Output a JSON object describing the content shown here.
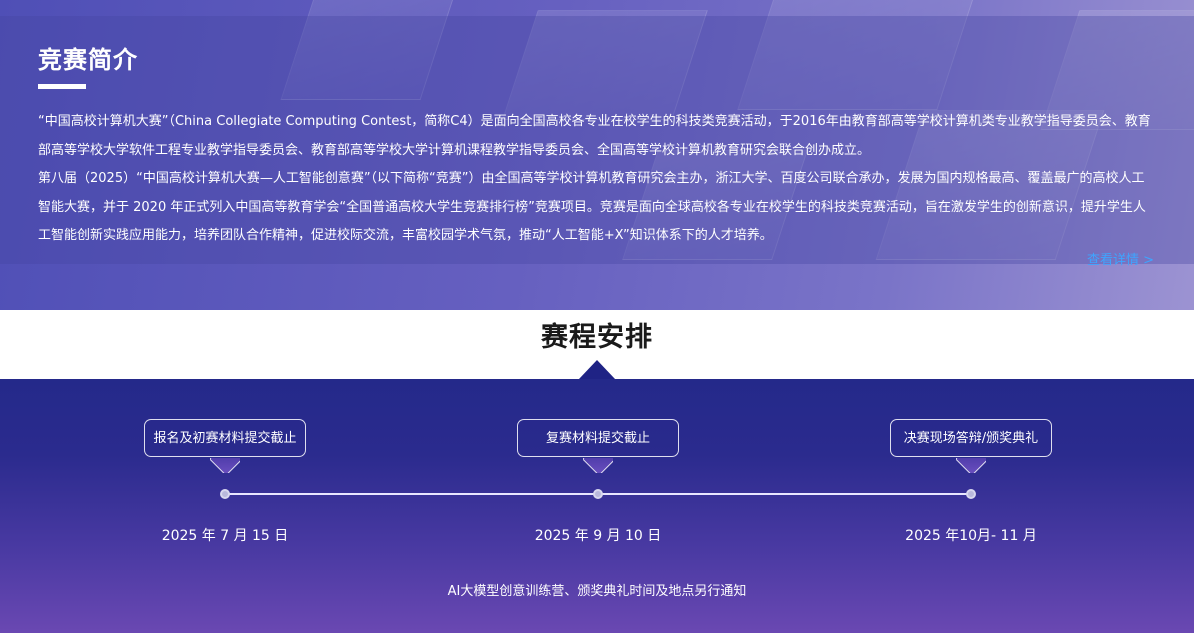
{
  "intro": {
    "title": "竞赛简介",
    "paragraph1": "“中国高校计算机大赛”（China Collegiate Computing Contest，简称C4）是面向全国高校各专业在校学生的科技类竞赛活动，于2016年由教育部高等学校计算机类专业教学指导委员会、教育部高等学校大学软件工程专业教学指导委员会、教育部高等学校大学计算机课程教学指导委员会、全国高等学校计算机教育研究会联合创办成立。",
    "paragraph2": "第八届（2025）“中国高校计算机大赛—人工智能创意赛”（以下简称“竞赛”）由全国高等学校计算机教育研究会主办，浙江大学、百度公司联合承办，发展为国内规格最高、覆盖最广的高校人工智能大赛，并于 2020 年正式列入中国高等教育学会“全国普通高校大学生竞赛排行榜”竞赛项目。竞赛是面向全球高校各专业在校学生的科技类竞赛活动，旨在激发学生的创新意识，提升学生人工智能创新实践应用能力，培养团队合作精神，促进校际交流，丰富校园学术气氛，推动“人工智能+X”知识体系下的人才培养。",
    "more_link": "查看详情 >"
  },
  "schedule": {
    "title": "赛程安排",
    "events": [
      {
        "label": "报名及初赛材料提交截止",
        "date": "2025 年 7 月 15 日"
      },
      {
        "label": "复赛材料提交截止",
        "date": "2025 年 9 月 10 日"
      },
      {
        "label": "决赛现场答辩/颁奖典礼",
        "date": "2025 年10月- 11 月"
      }
    ],
    "notice": "AI大模型创意训练营、颁奖典礼时间及地点另行通知"
  },
  "colors": {
    "intro_bg_start": "#4f4fb6",
    "intro_bg_end": "#9c93d2",
    "schedule_bg_start": "#24298a",
    "schedule_bg_end": "#6a48b2",
    "link": "#3ea5ff"
  }
}
